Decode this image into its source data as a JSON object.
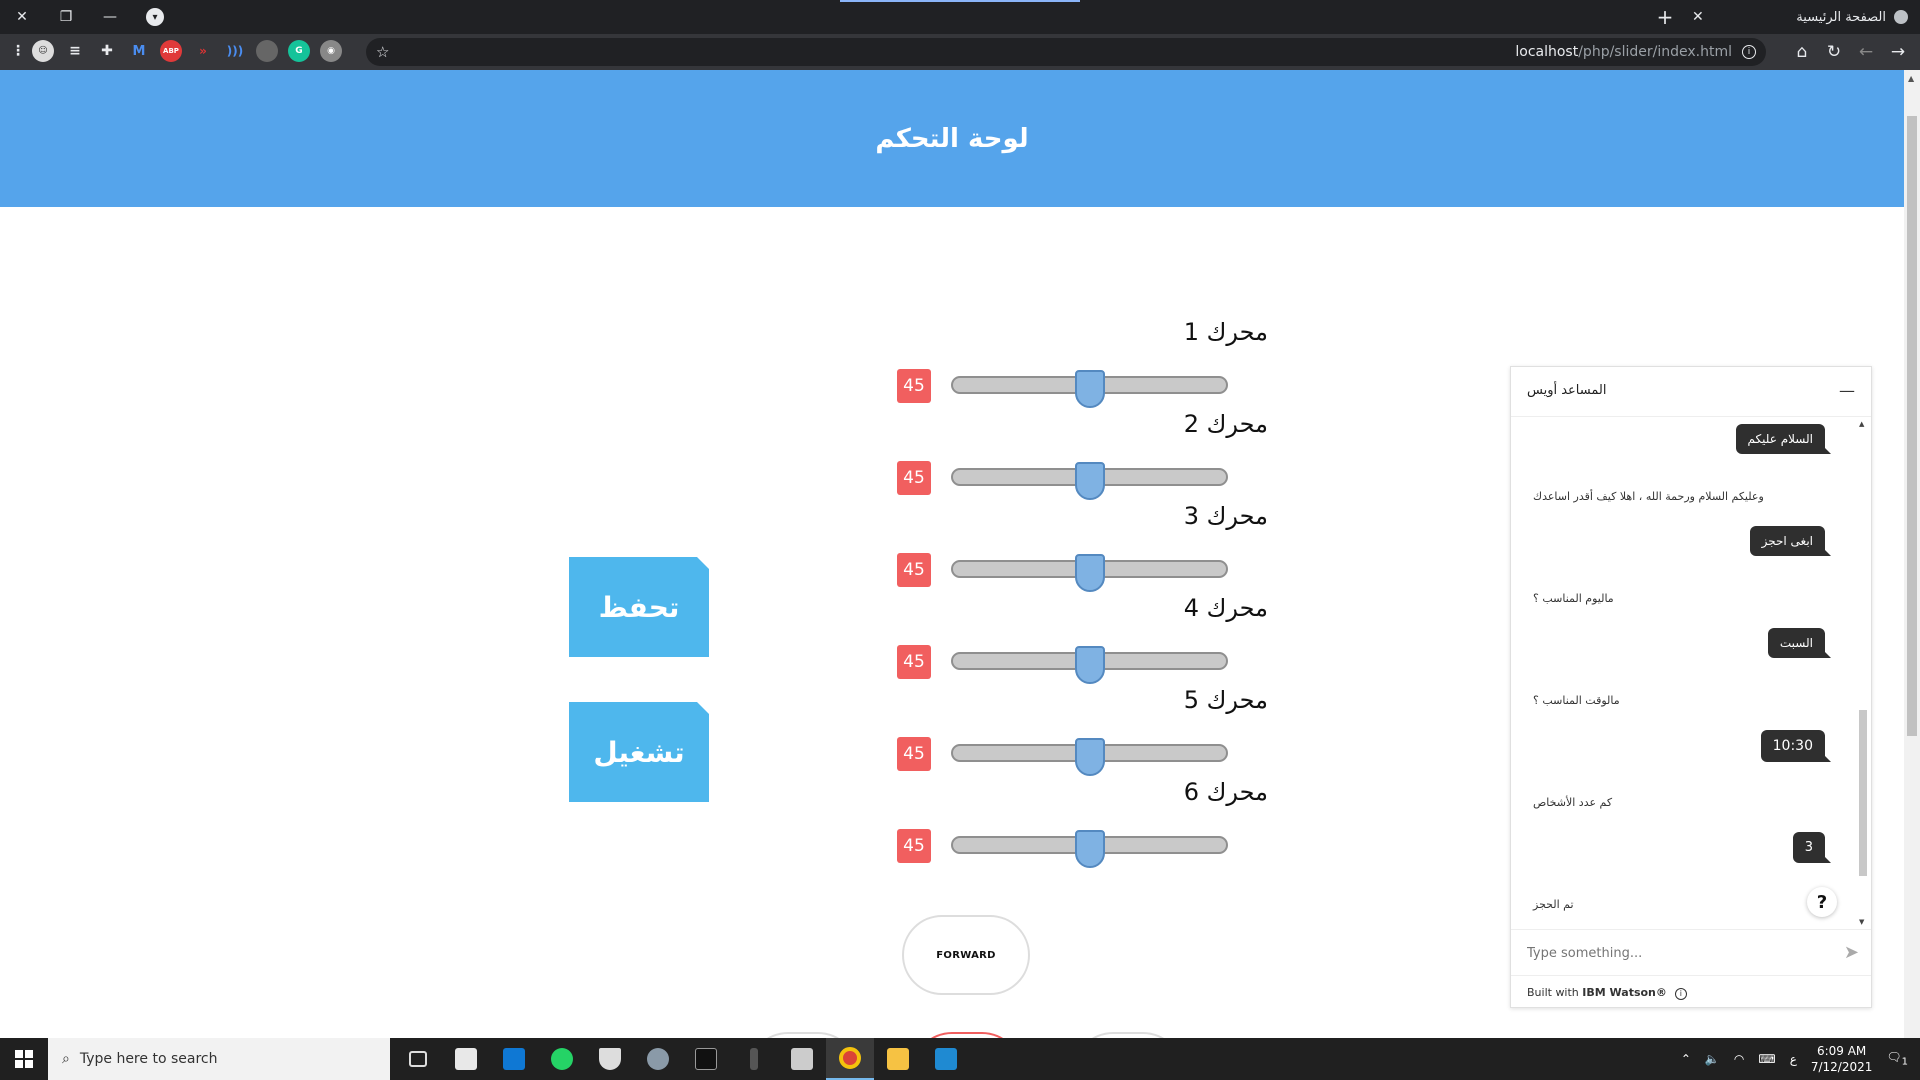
{
  "browser": {
    "tab_title": "الصفحة الرئيسية",
    "url_host": "localhost",
    "url_path": "/php/slider/index.html"
  },
  "page": {
    "header_title": "لوحة التحكم",
    "motors": [
      {
        "label": "محرك 1",
        "value": "45"
      },
      {
        "label": "محرك 2",
        "value": "45"
      },
      {
        "label": "محرك 3",
        "value": "45"
      },
      {
        "label": "محرك 4",
        "value": "45"
      },
      {
        "label": "محرك 5",
        "value": "45"
      },
      {
        "label": "محرك 6",
        "value": "45"
      }
    ],
    "save_label": "تحفظ",
    "run_label": "تشغيل",
    "forward_label": "FORWARD"
  },
  "chat": {
    "title": "المساعد أويس",
    "messages": [
      {
        "from": "user",
        "text": "السلام عليكم"
      },
      {
        "from": "bot",
        "text": "وعليكم السلام ورحمة الله ، اهلا كيف أقدر اساعدك"
      },
      {
        "from": "user",
        "text": "ابغى احجز"
      },
      {
        "from": "bot",
        "text": "ماليوم المناسب ؟"
      },
      {
        "from": "user",
        "text": "السبت"
      },
      {
        "from": "bot",
        "text": "مالوقت المناسب ؟"
      },
      {
        "from": "user",
        "text": "10:30"
      },
      {
        "from": "bot",
        "text": "كم عدد الأشخاص"
      },
      {
        "from": "user",
        "text": "3"
      },
      {
        "from": "bot",
        "text": "تم الحجز"
      }
    ],
    "help_label": "?",
    "input_placeholder": "Type something...",
    "footer_prefix": "Built with ",
    "footer_brand": "IBM Watson®"
  },
  "taskbar": {
    "search_placeholder": "Type here to search",
    "time": "6:09 AM",
    "date": "7/12/2021",
    "lang": "ع",
    "notification_count": "1"
  }
}
